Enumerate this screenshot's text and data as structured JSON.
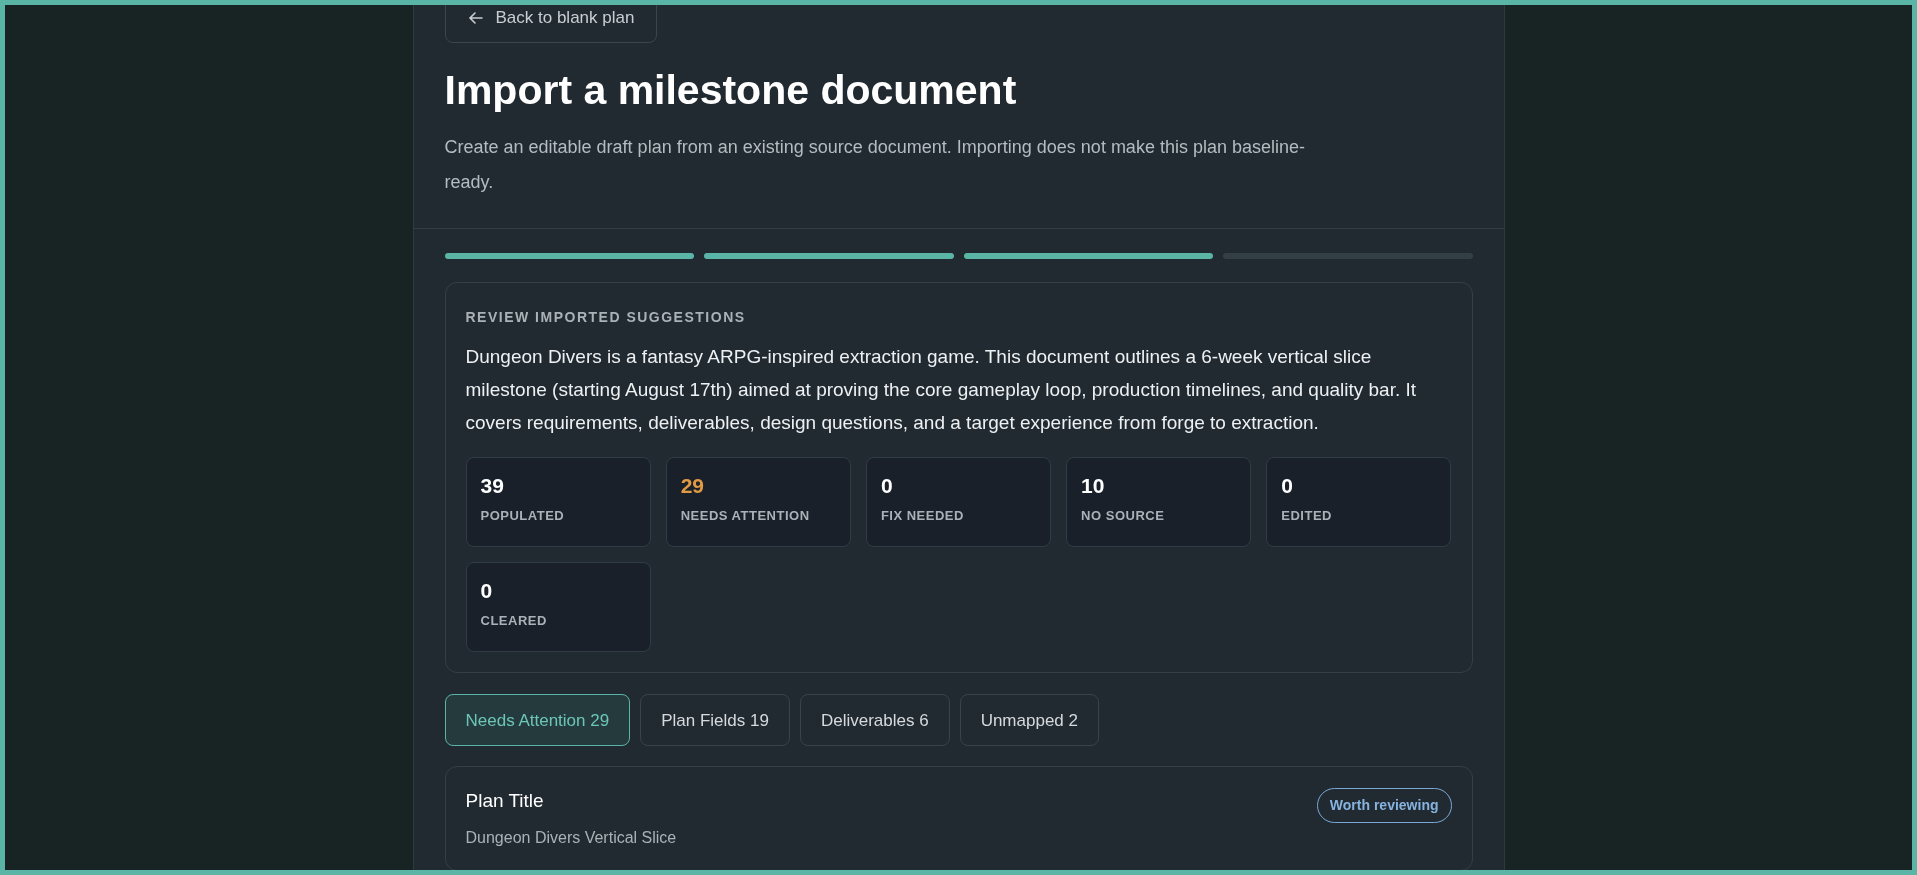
{
  "back_button": {
    "label": "Back to blank plan"
  },
  "title": "Import a milestone document",
  "description": "Create an editable draft plan from an existing source document. Importing does not make this plan baseline-ready.",
  "steps": [
    {
      "done": true
    },
    {
      "done": true
    },
    {
      "done": true
    },
    {
      "done": false
    }
  ],
  "review": {
    "heading": "REVIEW IMPORTED SUGGESTIONS",
    "summary": "Dungeon Divers is a fantasy ARPG-inspired extraction game. This document outlines a 6-week vertical slice milestone (starting August 17th) aimed at proving the core gameplay loop, production timelines, and quality bar. It covers requirements, deliverables, design questions, and a target experience from forge to extraction.",
    "stats": [
      {
        "value": "39",
        "label": "POPULATED",
        "highlight": false
      },
      {
        "value": "29",
        "label": "NEEDS ATTENTION",
        "highlight": true
      },
      {
        "value": "0",
        "label": "FIX NEEDED",
        "highlight": false
      },
      {
        "value": "10",
        "label": "NO SOURCE",
        "highlight": false
      },
      {
        "value": "0",
        "label": "EDITED",
        "highlight": false
      },
      {
        "value": "0",
        "label": "CLEARED",
        "highlight": false
      }
    ]
  },
  "tabs": [
    {
      "label": "Needs Attention 29",
      "selected": true
    },
    {
      "label": "Plan Fields 19",
      "selected": false
    },
    {
      "label": "Deliverables 6",
      "selected": false
    },
    {
      "label": "Unmapped 2",
      "selected": false
    }
  ],
  "items": [
    {
      "title": "Plan Title",
      "value": "Dungeon Divers Vertical Slice",
      "badge": "Worth reviewing"
    }
  ]
}
